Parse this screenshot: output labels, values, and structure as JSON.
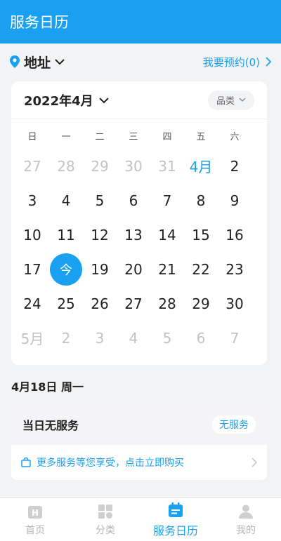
{
  "app_title": "服务日历",
  "location": {
    "label": "地址"
  },
  "booking": {
    "label": "我要预约(0)"
  },
  "calendar": {
    "month_title": "2022年4月",
    "category_filter": "品类",
    "weekdays": [
      "日",
      "一",
      "二",
      "三",
      "四",
      "五",
      "六"
    ],
    "days": [
      {
        "text": "27",
        "state": "muted"
      },
      {
        "text": "28",
        "state": "muted"
      },
      {
        "text": "29",
        "state": "muted"
      },
      {
        "text": "30",
        "state": "muted"
      },
      {
        "text": "31",
        "state": "muted"
      },
      {
        "text": "4月",
        "state": "accent"
      },
      {
        "text": "2",
        "state": "normal"
      },
      {
        "text": "3",
        "state": "normal"
      },
      {
        "text": "4",
        "state": "normal"
      },
      {
        "text": "5",
        "state": "normal"
      },
      {
        "text": "6",
        "state": "normal"
      },
      {
        "text": "7",
        "state": "normal"
      },
      {
        "text": "8",
        "state": "normal"
      },
      {
        "text": "9",
        "state": "normal"
      },
      {
        "text": "10",
        "state": "normal"
      },
      {
        "text": "11",
        "state": "normal"
      },
      {
        "text": "12",
        "state": "normal"
      },
      {
        "text": "13",
        "state": "normal"
      },
      {
        "text": "14",
        "state": "normal"
      },
      {
        "text": "15",
        "state": "normal"
      },
      {
        "text": "16",
        "state": "normal"
      },
      {
        "text": "17",
        "state": "normal"
      },
      {
        "text": "今",
        "state": "today"
      },
      {
        "text": "19",
        "state": "normal"
      },
      {
        "text": "20",
        "state": "normal"
      },
      {
        "text": "21",
        "state": "normal"
      },
      {
        "text": "22",
        "state": "normal"
      },
      {
        "text": "23",
        "state": "normal"
      },
      {
        "text": "24",
        "state": "normal"
      },
      {
        "text": "25",
        "state": "normal"
      },
      {
        "text": "26",
        "state": "normal"
      },
      {
        "text": "27",
        "state": "normal"
      },
      {
        "text": "28",
        "state": "normal"
      },
      {
        "text": "29",
        "state": "normal"
      },
      {
        "text": "30",
        "state": "normal"
      },
      {
        "text": "5月",
        "state": "muted"
      },
      {
        "text": "2",
        "state": "muted"
      },
      {
        "text": "3",
        "state": "muted"
      },
      {
        "text": "4",
        "state": "muted"
      },
      {
        "text": "5",
        "state": "muted"
      },
      {
        "text": "6",
        "state": "muted"
      },
      {
        "text": "7",
        "state": "muted"
      }
    ]
  },
  "selected_date": "4月18日 周一",
  "service": {
    "title": "当日无服务",
    "badge": "无服务",
    "promo": "更多服务等您享受，点击立即购买"
  },
  "tabs": [
    {
      "label": "首页",
      "icon": "home-icon",
      "active": false
    },
    {
      "label": "分类",
      "icon": "category-icon",
      "active": false
    },
    {
      "label": "服务日历",
      "icon": "calendar-icon",
      "active": true
    },
    {
      "label": "我的",
      "icon": "profile-icon",
      "active": false
    }
  ],
  "colors": {
    "accent": "#1aa0f0",
    "muted": "#c2c2c2",
    "background": "#f2f3f5"
  }
}
